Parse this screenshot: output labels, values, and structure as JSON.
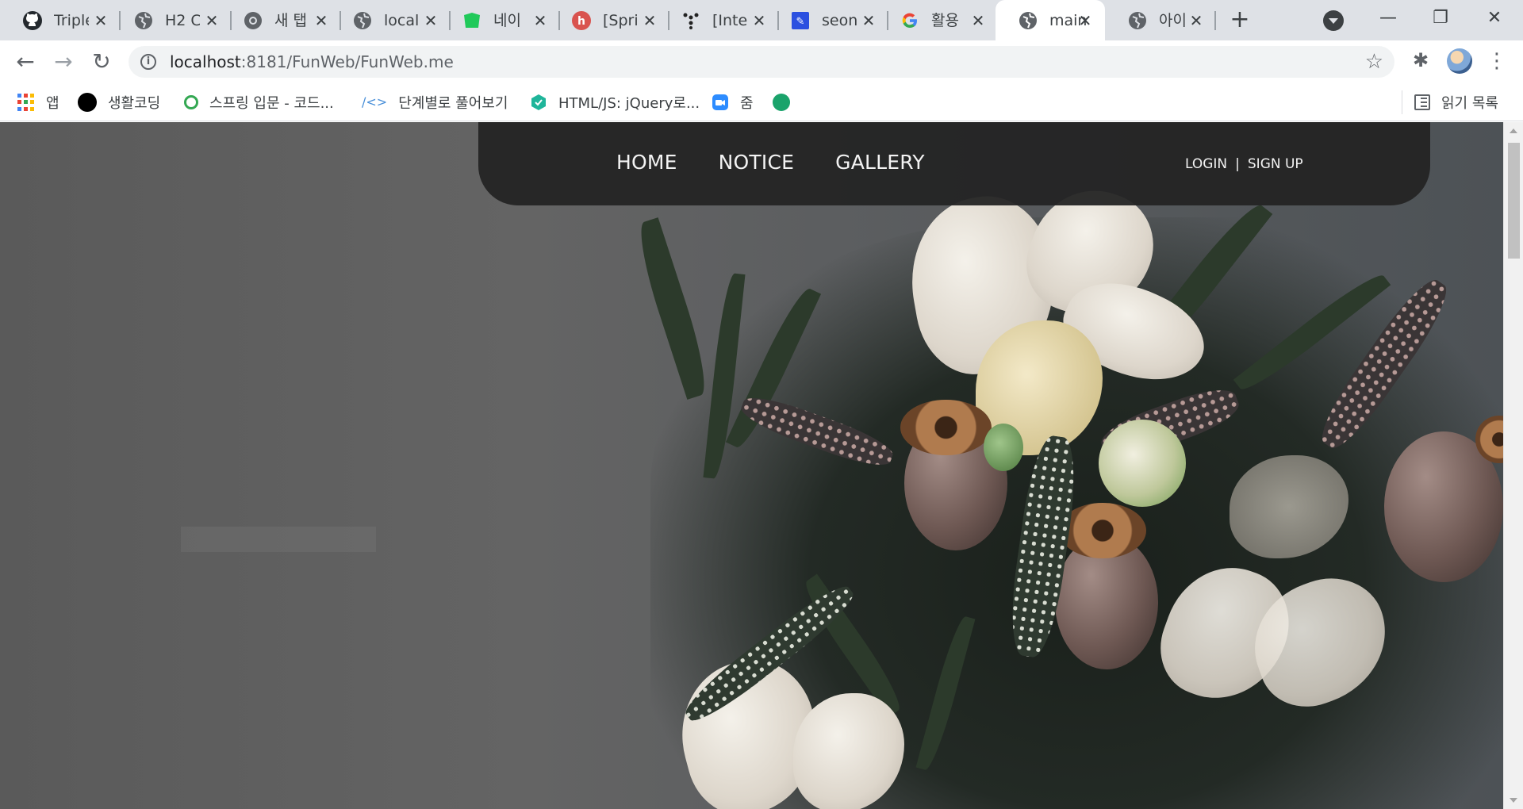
{
  "browser": {
    "tabs": [
      {
        "title": "Triple",
        "icon": "github-icon"
      },
      {
        "title": "H2 C",
        "icon": "globe-icon"
      },
      {
        "title": "새 탭",
        "icon": "chrome-icon"
      },
      {
        "title": "local",
        "icon": "globe-icon"
      },
      {
        "title": "네이",
        "icon": "naver-icon"
      },
      {
        "title": "[Spri",
        "icon": "inflearn-icon"
      },
      {
        "title": "[Inte",
        "icon": "dots-icon"
      },
      {
        "title": "seon",
        "icon": "blog-icon"
      },
      {
        "title": "활용",
        "icon": "google-icon"
      },
      {
        "title": "main",
        "icon": "globe-icon",
        "active": true
      },
      {
        "title": "아이",
        "icon": "globe-icon"
      }
    ],
    "address": {
      "host": "localhost",
      "path": ":8181/FunWeb/FunWeb.me"
    },
    "bookmarks": [
      {
        "label": "앱",
        "icon": "apps-icon"
      },
      {
        "label": "생활코딩",
        "icon": "circle-icon"
      },
      {
        "label": "스프링 입문 - 코드...",
        "icon": "inflearn-icon"
      },
      {
        "label": "단계별로 풀어보기",
        "icon": "code-icon"
      },
      {
        "label": "HTML/JS: jQuery로...",
        "icon": "hex-icon"
      },
      {
        "label": "줌",
        "icon": "zoom-icon"
      },
      {
        "label": "",
        "icon": "green-icon"
      }
    ],
    "reading_list": "읽기 목록",
    "colors": {
      "tabstrip": "#dee1e6",
      "toolbar": "#ffffff",
      "omnibox": "#f1f3f4"
    }
  },
  "site": {
    "nav": [
      "HOME",
      "NOTICE",
      "GALLERY"
    ],
    "login": "LOGIN",
    "divider": "|",
    "signup": "SIGN UP",
    "colors": {
      "header": "#242424",
      "nav_text": "#f3f3f3"
    }
  }
}
